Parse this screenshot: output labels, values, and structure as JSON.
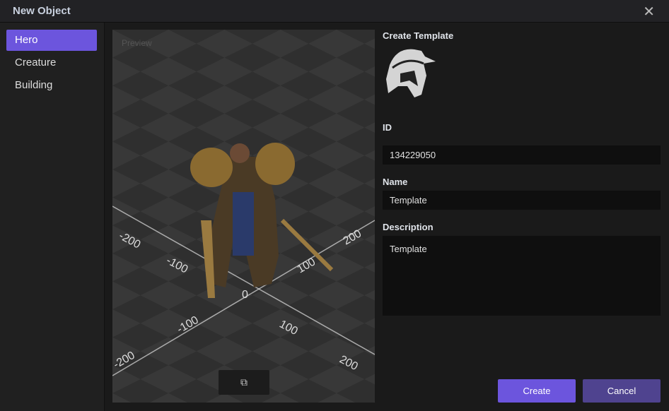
{
  "window": {
    "title": "New Object",
    "close_icon": "close-icon"
  },
  "sidebar": {
    "items": [
      {
        "label": "Hero",
        "active": true
      },
      {
        "label": "Creature"
      },
      {
        "label": "Building"
      }
    ]
  },
  "preview": {
    "label": "Preview",
    "axis_labels": [
      "-200",
      "-100",
      "0",
      "100",
      "200",
      "-200",
      "-100",
      "100",
      "200"
    ],
    "toggle_icon": "swap-view-icon"
  },
  "form": {
    "header": "Create Template",
    "icon": "spartan-helmet-icon",
    "id_label": "ID",
    "id_value": "134229050",
    "name_label": "Name",
    "name_value": "Template",
    "description_label": "Description",
    "description_value": "Template"
  },
  "buttons": {
    "create": "Create",
    "cancel": "Cancel"
  },
  "colors": {
    "accent": "#6c55dd",
    "cancel": "#4f438f"
  }
}
